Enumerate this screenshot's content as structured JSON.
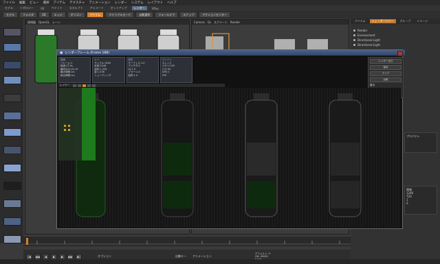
{
  "menubar": [
    "ファイル",
    "編集",
    "ビュー",
    "選択",
    "アイテム",
    "テクスチャ",
    "アニメーション",
    "レンダー",
    "システム",
    "レイアウト",
    "ヘルプ"
  ],
  "toprow": [
    "モデル",
    "トポロジー",
    "UV",
    "ペイント",
    "スカルプト",
    "アニメート",
    "セットアップ",
    "レンダー",
    "VRay"
  ],
  "toolbar": [
    "モデル",
    "フォルダ",
    "3D",
    "エッジ",
    "ポリゴン",
    "アイテム",
    "マテリアルモード",
    "自動選択",
    "フォールオフ",
    "スナップ",
    "アクションセンター"
  ],
  "viewport_left": {
    "title": "透視図",
    "tabs": [
      "OpenGL",
      "シーン"
    ]
  },
  "viewport_right": {
    "title": "Camera",
    "tabs": [
      "GL",
      "スクリーン",
      "Render"
    ]
  },
  "right_panel": {
    "tabs": [
      "アイテム",
      "シェーダーツリー",
      "グループ",
      "イメージ"
    ],
    "items": [
      "Render",
      "Environment",
      "Directional Light",
      "Directional Light"
    ],
    "section_labels": [
      "プロパティ",
      "情報"
    ],
    "list_labels": [
      "1280",
      "720",
      "1",
      "0"
    ]
  },
  "render_window": {
    "title": "レンダーフレーム (Frame 188)",
    "col1_head": "描画",
    "col1": [
      "フレーム:1",
      "経過:12.9s",
      "最初のGI:20.10",
      "最大時間:1m",
      "総合時間:1m"
    ],
    "col2_head": "レイ",
    "col2": [
      "サンプル:3262",
      "反射:2048",
      "屈折:1,536",
      "影:1,536",
      "シェーディング"
    ],
    "col3_head": "設定",
    "col3": [
      "サーフェス:1.0",
      "アンチ:0.5",
      "GI:1.0",
      "ブラー:1.0",
      "品質:1.0"
    ],
    "col4_head": "エンジン",
    "col4": [
      "スレッド",
      "メモリ:100",
      "パス:30",
      "GPU:1",
      "FPS"
    ],
    "side_buttons": [
      "レンダー出力",
      "保存",
      "クリア",
      "比較"
    ],
    "label_left": "レイヤー",
    "label_right": "露出"
  },
  "bottom_status": {
    "left_label": "オプション",
    "mid_label": "自動キー",
    "right_label": "アニメーション",
    "info": [
      "デフォルト: 0",
      "ON: 40000",
      "0 sub"
    ]
  }
}
